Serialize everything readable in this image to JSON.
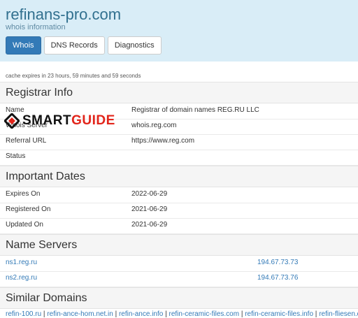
{
  "header": {
    "domain": "refinans-pro.com",
    "subtitle": "whois information",
    "tabs": [
      {
        "label": "Whois",
        "active": true
      },
      {
        "label": "DNS Records",
        "active": false
      },
      {
        "label": "Diagnostics",
        "active": false
      }
    ]
  },
  "cache_note": "cache expires in 23 hours, 59 minutes and 59 seconds",
  "registrar": {
    "title": "Registrar Info",
    "rows": [
      {
        "label": "Name",
        "value": "Registrar of domain names REG.RU LLC"
      },
      {
        "label": "Whois Server",
        "value": "whois.reg.com"
      },
      {
        "label": "Referral URL",
        "value": "https://www.reg.com"
      },
      {
        "label": "Status",
        "value": ""
      }
    ]
  },
  "dates": {
    "title": "Important Dates",
    "rows": [
      {
        "label": "Expires On",
        "value": "2022-06-29"
      },
      {
        "label": "Registered On",
        "value": "2021-06-29"
      },
      {
        "label": "Updated On",
        "value": "2021-06-29"
      }
    ]
  },
  "name_servers": {
    "title": "Name Servers",
    "rows": [
      {
        "name": "ns1.reg.ru",
        "ip": "194.67.73.73"
      },
      {
        "name": "ns2.reg.ru",
        "ip": "194.67.73.76"
      }
    ]
  },
  "similar": {
    "title": "Similar Domains",
    "links": [
      "refin-100.ru",
      "refin-ance-hom.net.in",
      "refin-ance.info",
      "refin-ceramic-files.com",
      "refin-ceramic-files.info",
      "refin-fliesen.de"
    ]
  },
  "watermark": {
    "smart": "SMART",
    "guide": "GUIDE"
  },
  "colors": {
    "header_bg": "#d9edf7",
    "accent": "#337ab7",
    "watermark_red": "#e2241a"
  }
}
